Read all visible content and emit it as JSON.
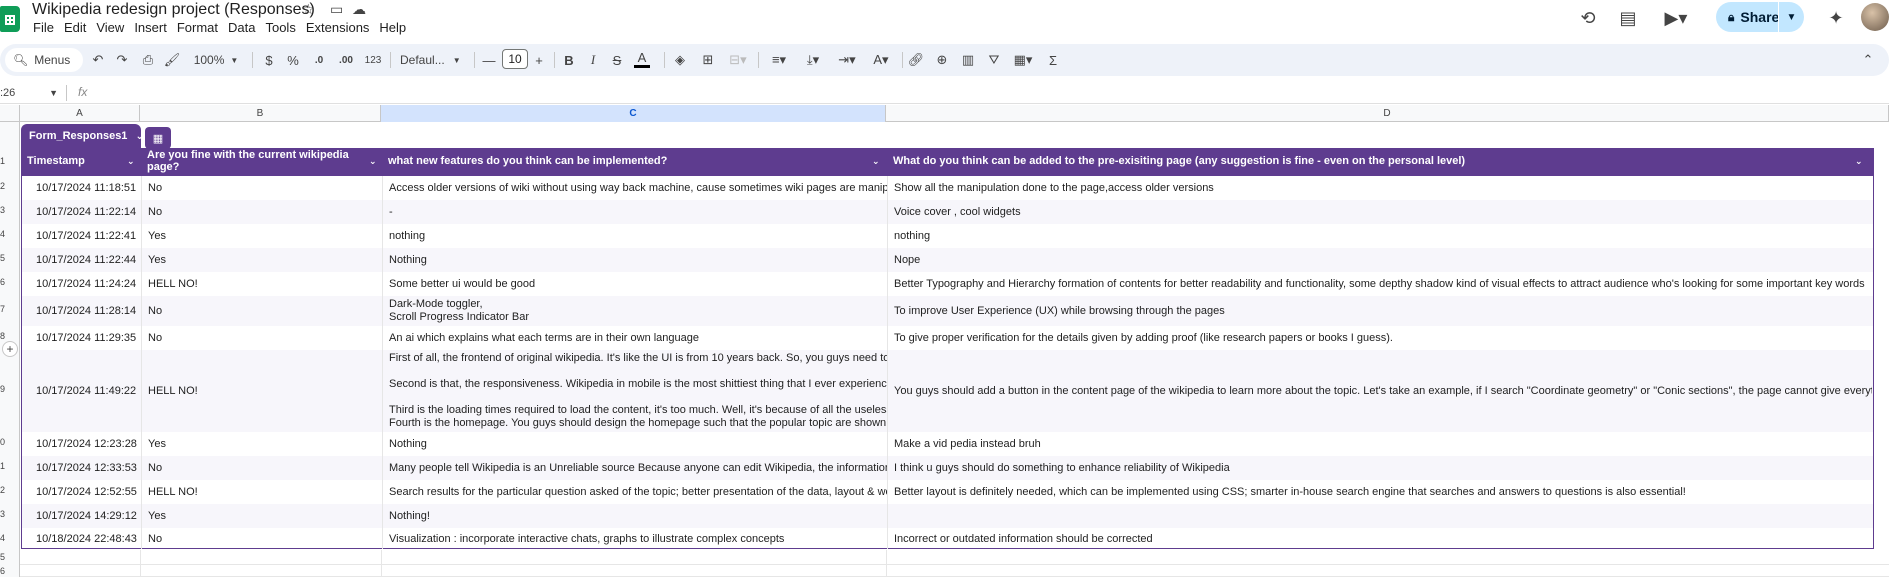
{
  "app": {
    "doc_title": "Wikipedia redesign project (Responses)",
    "icons": {
      "star": "star-icon",
      "move": "folder-icon",
      "cloud": "cloud-status-icon"
    }
  },
  "menu": [
    "File",
    "Edit",
    "View",
    "Insert",
    "Format",
    "Data",
    "Tools",
    "Extensions",
    "Help"
  ],
  "top_right": {
    "share_label": "Share"
  },
  "toolbar": {
    "search_label": "Menus",
    "zoom": "100%",
    "currency": "$",
    "percent": "%",
    "dec_decrease": ".0",
    "dec_increase": ".00",
    "number_format": "123",
    "font": "Defaul...",
    "font_size": "10",
    "minus": "—",
    "plus": "+",
    "bold": "B",
    "italic": "I",
    "strike": "S",
    "text_color": "A",
    "sigma": "Σ"
  },
  "formula_bar": {
    "name_box": ":26",
    "fx": "fx"
  },
  "columns": [
    "A",
    "B",
    "C",
    "D"
  ],
  "row_numbers": [
    "1",
    "2",
    "3",
    "4",
    "5",
    "6",
    "7",
    "8",
    "9",
    "0",
    "1",
    "2",
    "3",
    "4",
    "5",
    "6"
  ],
  "table": {
    "name": "Form_Responses1",
    "headers": [
      "Timestamp",
      "Are you fine with the current wikipedia page?",
      "what new features do you think can be implemented?",
      "What do you think can be added to the pre-exisiting page (any suggestion is fine - even on the personal level)"
    ],
    "rows": [
      {
        "ts": "10/17/2024 11:18:51",
        "fine": "No",
        "features": [
          "Access older versions of wiki without using way back machine, cause sometimes wiki pages are manipula"
        ],
        "added": [
          "Show all the manipulation done to the page,access older versions"
        ]
      },
      {
        "ts": "10/17/2024 11:22:14",
        "fine": "No",
        "features": [
          "-"
        ],
        "added": [
          "Voice cover , cool widgets"
        ]
      },
      {
        "ts": "10/17/2024 11:22:41",
        "fine": "Yes",
        "features": [
          "nothing"
        ],
        "added": [
          "nothing"
        ]
      },
      {
        "ts": "10/17/2024 11:22:44",
        "fine": "Yes",
        "features": [
          "Nothing"
        ],
        "added": [
          "Nope"
        ]
      },
      {
        "ts": "10/17/2024 11:24:24",
        "fine": "HELL NO!",
        "features": [
          "Some better ui would be good"
        ],
        "added": [
          "Better Typography and Hierarchy formation of contents for better readability and functionality, some depthy shadow kind of visual effects to attract audience who's looking for some important key words"
        ]
      },
      {
        "ts": "10/17/2024 11:28:14",
        "fine": "No",
        "features": [
          "Dark-Mode toggler,",
          "Scroll Progress Indicator Bar"
        ],
        "added": [
          "To improve User Experience (UX) while browsing through the pages"
        ]
      },
      {
        "ts": "10/17/2024 11:29:35",
        "fine": "No",
        "features": [
          "An ai which explains what each terms are in their own language"
        ],
        "added": [
          "To give proper verification for the details given by adding proof (like research papers or books I guess)."
        ]
      },
      {
        "ts": "10/17/2024 11:49:22",
        "fine": "HELL NO!",
        "features": [
          "First of all, the frontend of original wikipedia. It's like the UI is from 10 years back. So, you guys need to im",
          "",
          "Second is that, the responsiveness. Wikipedia in mobile is the most shittiest thing that I ever experienced.",
          "",
          "Third is the loading times required to load the content, it's too much. Well, it's because of all the useless th",
          "Fourth is the homepage. You guys should design the homepage such that the popular topic are shown the"
        ],
        "added": [
          "You guys should add a button in the content page of the wikipedia to learn more about the topic. Let's take an example, if I search \"Coordinate geometry\" or \"Conic sections\", the page cannot give everything ab"
        ]
      },
      {
        "ts": "10/17/2024 12:23:28",
        "fine": "Yes",
        "features": [
          "Nothing"
        ],
        "added": [
          "Make a vid pedia instead bruh"
        ]
      },
      {
        "ts": "10/17/2024 12:33:53",
        "fine": "No",
        "features": [
          "Many people tell Wikipedia is an Unreliable source Because anyone can edit Wikipedia, the information ma"
        ],
        "added": [
          "I think u guys should do something to enhance reliability of Wikipedia"
        ]
      },
      {
        "ts": "10/17/2024 12:52:55",
        "fine": "HELL NO!",
        "features": [
          "Search results for the particular question asked of the topic; better presentation of the data, layout & webp"
        ],
        "added": [
          "Better layout is definitely needed, which can be implemented using CSS; smarter in-house search engine that searches and answers to questions is also essential!"
        ]
      },
      {
        "ts": "10/17/2024 14:29:12",
        "fine": "Yes",
        "features": [
          "Nothing!"
        ],
        "added": [
          ""
        ]
      },
      {
        "ts": "10/18/2024 22:48:43",
        "fine": "No",
        "features": [
          "Visualization : incorporate interactive chats, graphs to illustrate complex concepts"
        ],
        "added": [
          "Incorrect or outdated information should be corrected"
        ]
      }
    ]
  },
  "colors": {
    "table_header": "#5e3c8f",
    "selected_col": "#d3e3fd",
    "share_bg": "#c2e7ff",
    "logo": "#0f9d58"
  }
}
